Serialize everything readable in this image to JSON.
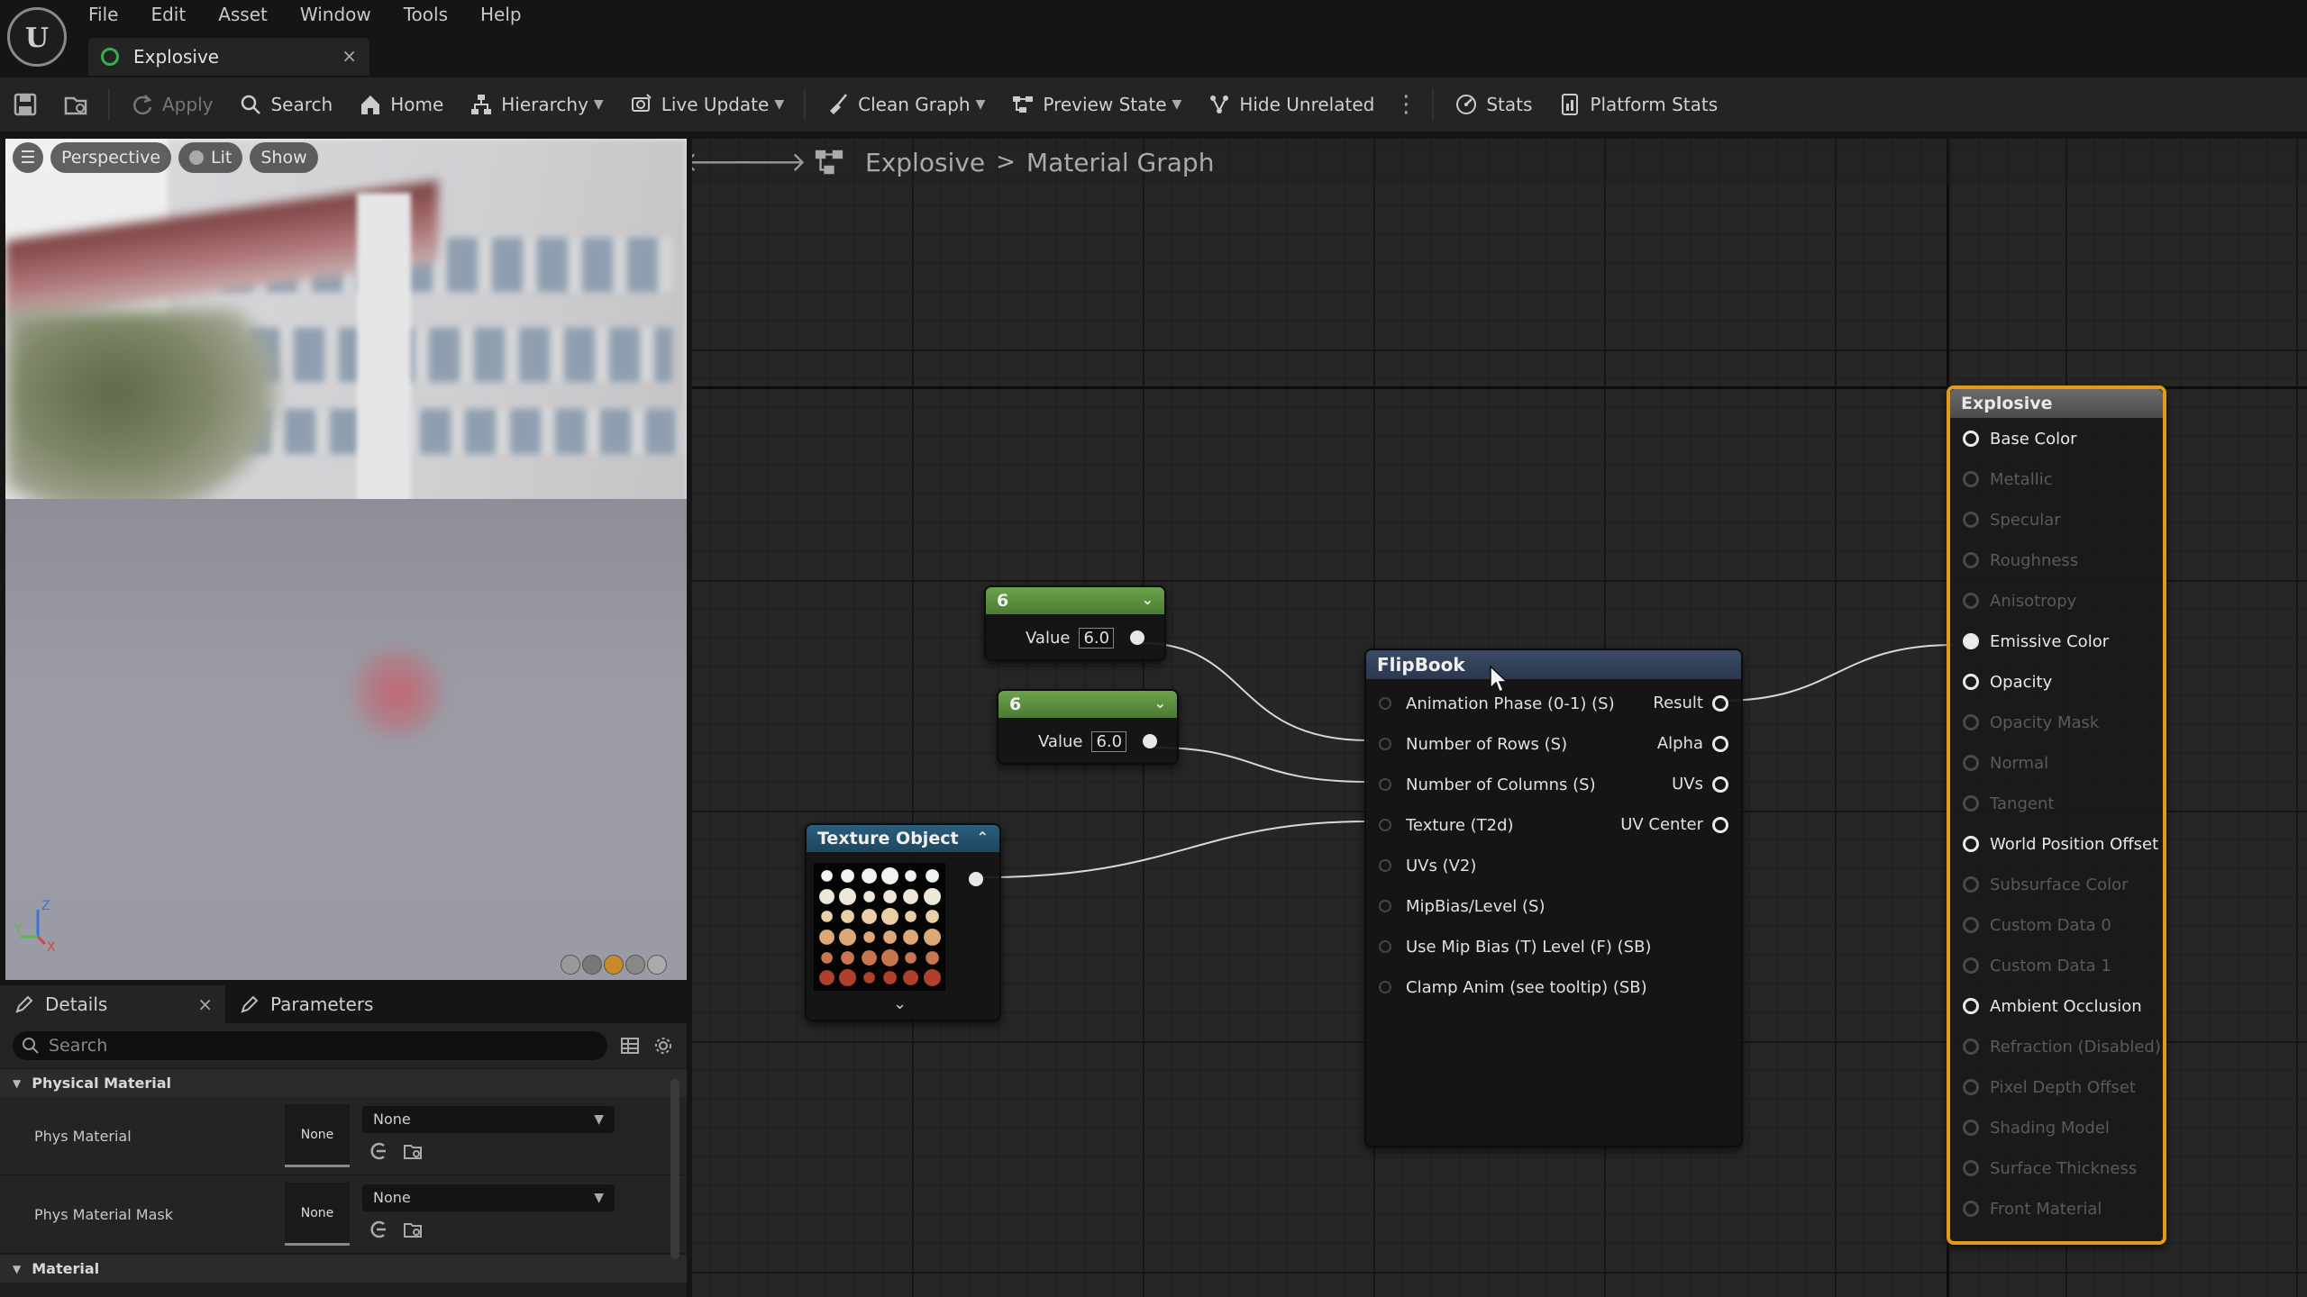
{
  "window": {
    "menu": [
      "File",
      "Edit",
      "Asset",
      "Window",
      "Tools",
      "Help"
    ],
    "asset_tab": {
      "label": "Explosive",
      "close": "×"
    }
  },
  "toolbar": {
    "apply": "Apply",
    "search": "Search",
    "home": "Home",
    "hierarchy": "Hierarchy",
    "live_update": "Live Update",
    "clean_graph": "Clean Graph",
    "preview_state": "Preview State",
    "hide_unrelated": "Hide Unrelated",
    "stats": "Stats",
    "platform_stats": "Platform Stats"
  },
  "viewport": {
    "perspective": "Perspective",
    "lit": "Lit",
    "show": "Show",
    "axis_z": "Z",
    "axis_x": "X",
    "axis_y": "Y"
  },
  "details": {
    "tabs": {
      "details": "Details",
      "parameters": "Parameters",
      "close": "×"
    },
    "search_placeholder": "Search",
    "section_physical": "Physical Material",
    "phys_material": {
      "label": "Phys Material",
      "thumb": "None",
      "value": "None"
    },
    "phys_material_mask": {
      "label": "Phys Material Mask",
      "thumb": "None",
      "value": "None"
    },
    "section_material": "Material"
  },
  "graph": {
    "crumb_asset": "Explosive",
    "crumb_sep": ">",
    "crumb_graph": "Material Graph",
    "const1": {
      "title": "6",
      "label": "Value",
      "value": "6.0"
    },
    "const2": {
      "title": "6",
      "label": "Value",
      "value": "6.0"
    },
    "texture_object": {
      "title": "Texture Object"
    },
    "flipbook": {
      "title": "FlipBook",
      "inputs": [
        "Animation  Phase (0-1) (S)",
        "Number of Rows (S)",
        "Number of Columns (S)",
        "Texture (T2d)",
        "UVs (V2)",
        "MipBias/Level (S)",
        "Use Mip Bias (T) Level (F) (SB)",
        "Clamp Anim (see tooltip) (SB)"
      ],
      "outputs": [
        "Result",
        "Alpha",
        "UVs",
        "UV Center"
      ]
    },
    "result": {
      "title": "Explosive",
      "pins": [
        {
          "label": "Base Color",
          "enabled": true
        },
        {
          "label": "Metallic",
          "enabled": false
        },
        {
          "label": "Specular",
          "enabled": false
        },
        {
          "label": "Roughness",
          "enabled": false
        },
        {
          "label": "Anisotropy",
          "enabled": false
        },
        {
          "label": "Emissive Color",
          "enabled": true,
          "connected": true
        },
        {
          "label": "Opacity",
          "enabled": true
        },
        {
          "label": "Opacity Mask",
          "enabled": false
        },
        {
          "label": "Normal",
          "enabled": false
        },
        {
          "label": "Tangent",
          "enabled": false
        },
        {
          "label": "World Position Offset",
          "enabled": true
        },
        {
          "label": "Subsurface Color",
          "enabled": false
        },
        {
          "label": "Custom Data 0",
          "enabled": false
        },
        {
          "label": "Custom Data 1",
          "enabled": false
        },
        {
          "label": "Ambient Occlusion",
          "enabled": true
        },
        {
          "label": "Refraction (Disabled)",
          "enabled": false
        },
        {
          "label": "Pixel Depth Offset",
          "enabled": false
        },
        {
          "label": "Shading Model",
          "enabled": false
        },
        {
          "label": "Surface Thickness",
          "enabled": false
        },
        {
          "label": "Front Material",
          "enabled": false
        }
      ]
    }
  },
  "colors": {
    "result_border": "#e39a1a",
    "constant_header": "#6ba34a",
    "texture_header": "#2a5e7c",
    "flipbook_header": "#3b4a66"
  }
}
